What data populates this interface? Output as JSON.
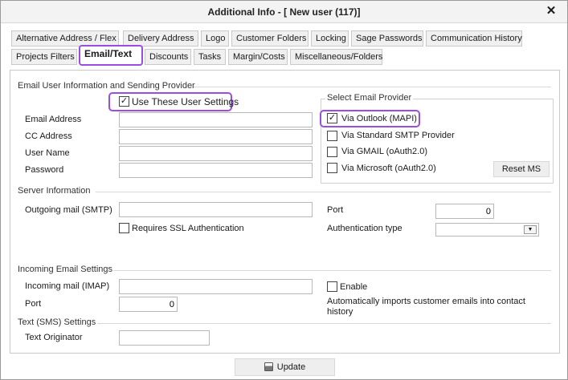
{
  "window": {
    "title": "Additional Info - [ New user (117)]"
  },
  "tabs_row1": [
    {
      "label": "Alternative Address / Flex"
    },
    {
      "label": "Delivery Address"
    },
    {
      "label": "Logo"
    },
    {
      "label": "Customer Folders"
    },
    {
      "label": "Locking"
    },
    {
      "label": "Sage Passwords"
    },
    {
      "label": "Communication History"
    }
  ],
  "tabs_row2": [
    {
      "label": "Projects Filters"
    },
    {
      "label": "Email/Text"
    },
    {
      "label": "Discounts"
    },
    {
      "label": "Tasks"
    },
    {
      "label": "Margin/Costs"
    },
    {
      "label": "Miscellaneous/Folders"
    }
  ],
  "email_user": {
    "section_label": "Email User Information and Sending Provider",
    "use_user_settings_label": "Use These User Settings",
    "use_user_settings_checked": true,
    "email_address_label": "Email Address",
    "email_address_value": "",
    "cc_address_label": "CC Address",
    "cc_address_value": "",
    "user_name_label": "User Name",
    "user_name_value": "",
    "password_label": "Password",
    "password_value": ""
  },
  "provider": {
    "group_label": "Select Email Provider",
    "options": [
      {
        "label": "Via Outlook (MAPI)",
        "checked": true
      },
      {
        "label": "Via Standard SMTP Provider",
        "checked": false
      },
      {
        "label": "Via GMAIL (oAuth2.0)",
        "checked": false
      },
      {
        "label": "Via Microsoft (oAuth2.0)",
        "checked": false
      }
    ],
    "reset_label": "Reset MS"
  },
  "server": {
    "section_label": "Server Information",
    "outgoing_label": "Outgoing mail (SMTP)",
    "outgoing_value": "",
    "port_label": "Port",
    "port_value": "0",
    "ssl_label": "Requires SSL Authentication",
    "ssl_checked": false,
    "auth_type_label": "Authentication type",
    "auth_type_value": ""
  },
  "incoming": {
    "section_label": "Incoming Email Settings",
    "incoming_label": "Incoming mail (IMAP)",
    "incoming_value": "",
    "port_label": "Port",
    "port_value": "0",
    "enable_label": "Enable",
    "enable_checked": false,
    "note": "Automatically imports customer emails into contact history"
  },
  "sms": {
    "section_label": "Text (SMS) Settings",
    "originator_label": "Text Originator",
    "originator_value": ""
  },
  "footer": {
    "update_label": "Update",
    "update_icon": "floppy-disk-icon"
  }
}
